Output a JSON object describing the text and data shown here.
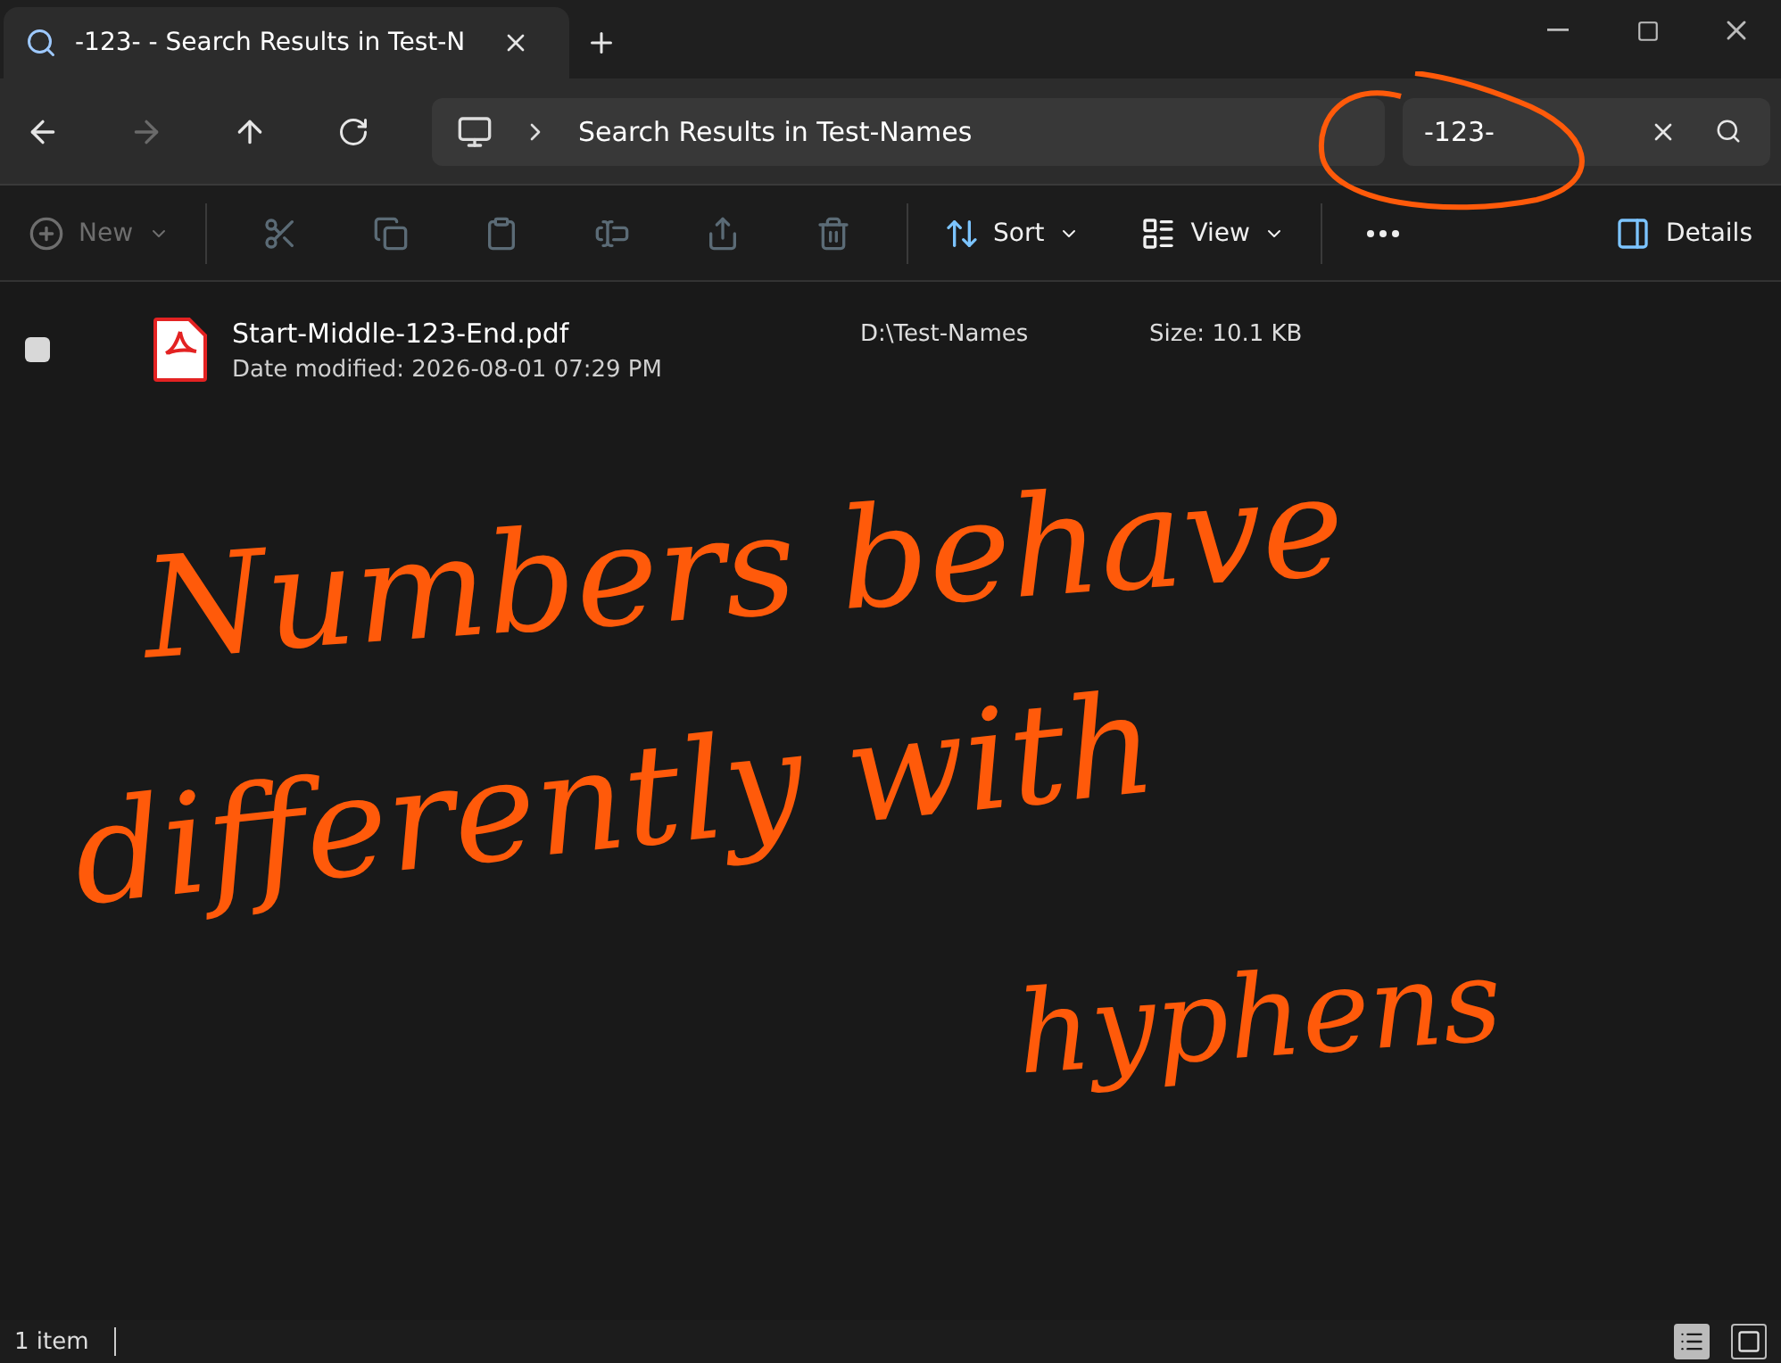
{
  "tab": {
    "title": "-123- - Search Results in Test-N",
    "selected": true
  },
  "nav": {
    "forward_disabled": true,
    "breadcrumb": "Search Results in Test-Names",
    "search_value": "-123-"
  },
  "toolbar": {
    "new": {
      "label": "New",
      "disabled": true
    },
    "actions": [
      {
        "disabled": true
      },
      {
        "disabled": true
      },
      {
        "disabled": true
      },
      {
        "disabled": true
      },
      {
        "disabled": true
      },
      {
        "disabled": true
      }
    ],
    "sort": {
      "label": "Sort"
    },
    "view": {
      "label": "View"
    },
    "details": {
      "label": "Details"
    }
  },
  "files": [
    {
      "name": "Start-Middle-123-End.pdf",
      "date_modified": "Date modified: 2026-08-01 07:29 PM",
      "folder": "D:\\Test-Names",
      "size": "Size: 10.1 KB",
      "checked": false
    }
  ],
  "annotation": {
    "lines": [
      "Numbers behave",
      "differently with",
      "hyphens"
    ]
  },
  "status_bar": {
    "count": "1 item",
    "views": [
      {
        "selected": true
      },
      {
        "selected": false
      }
    ]
  }
}
